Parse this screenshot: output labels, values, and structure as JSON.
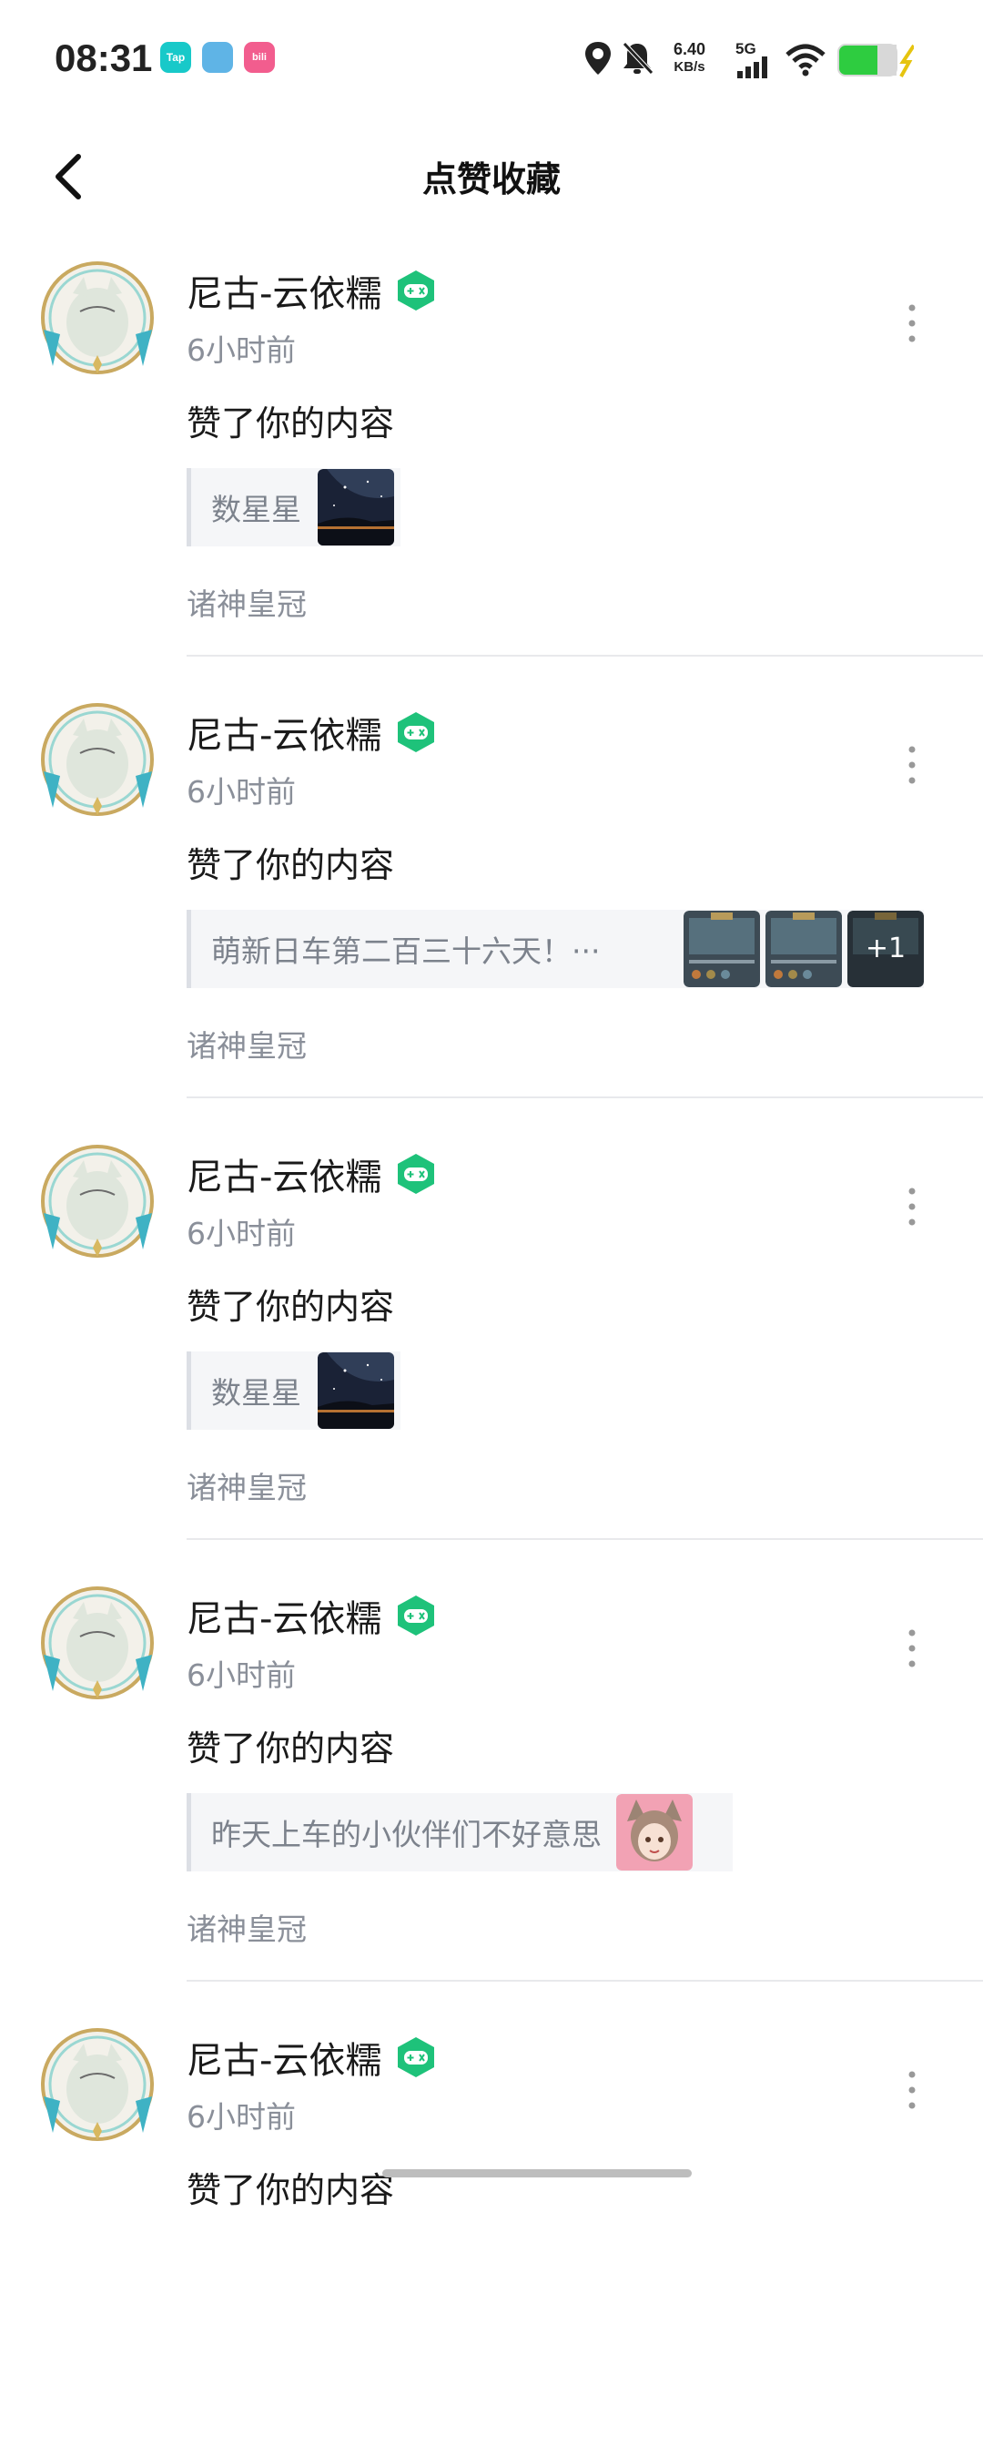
{
  "status_bar": {
    "time": "08:31",
    "app_icons": [
      {
        "label": "Tap",
        "color": "#18c9c9"
      },
      {
        "label": "",
        "color": "#5fb4e6"
      },
      {
        "label": "bili",
        "color": "#f25d8e"
      }
    ],
    "net_speed_value": "6.40",
    "net_speed_unit": "KB/s",
    "network": "5G",
    "battery_color": "#2ecc40"
  },
  "header": {
    "back_icon": "chevron-left-icon",
    "title": "点赞收藏"
  },
  "items": [
    {
      "user_name": "尼古-云依糯",
      "time_ago": "6小时前",
      "action": "赞了你的内容",
      "quote_text": "数星星",
      "thumbnails": [
        "night-sky-photo"
      ],
      "section": "诸神皇冠"
    },
    {
      "user_name": "尼古-云依糯",
      "time_ago": "6小时前",
      "action": "赞了你的内容",
      "quote_text": "萌新日车第二百三十六天！···",
      "thumbnails": [
        "game-screenshot",
        "game-screenshot",
        "game-screenshot"
      ],
      "extra_count": "+1",
      "section": "诸神皇冠"
    },
    {
      "user_name": "尼古-云依糯",
      "time_ago": "6小时前",
      "action": "赞了你的内容",
      "quote_text": "数星星",
      "thumbnails": [
        "night-sky-photo"
      ],
      "section": "诸神皇冠"
    },
    {
      "user_name": "尼古-云依糯",
      "time_ago": "6小时前",
      "action": "赞了你的内容",
      "quote_text": "昨天上车的小伙伴们不好意思",
      "thumbnails": [
        "anime-girl-avatar"
      ],
      "section": "诸神皇冠"
    },
    {
      "user_name": "尼古-云依糯",
      "time_ago": "6小时前",
      "action": "赞了你的内容",
      "quote_text": "",
      "thumbnails": [],
      "section": ""
    }
  ],
  "colors": {
    "badge_green": "#1ec27a",
    "secondary_text": "#8a8f99"
  }
}
